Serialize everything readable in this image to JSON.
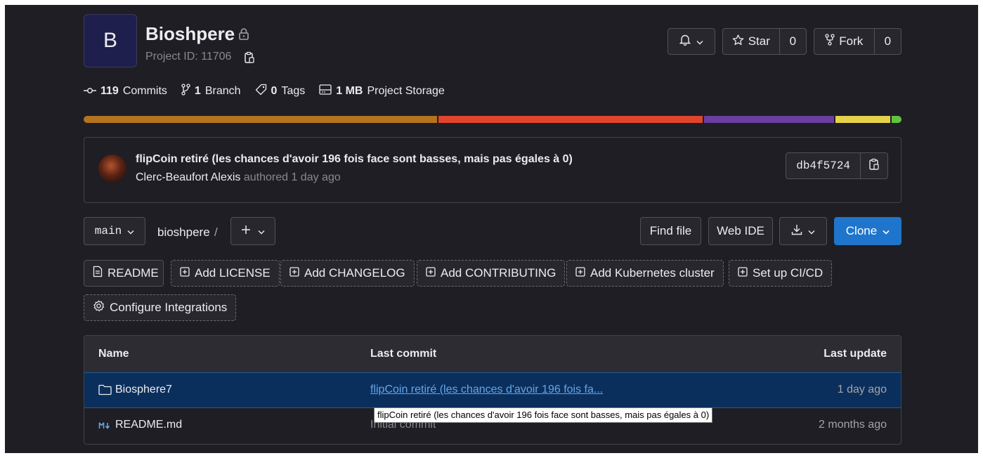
{
  "project": {
    "avatar_letter": "B",
    "title": "Bioshpere",
    "project_id": "Project ID: 11706"
  },
  "actions": {
    "star_label": "Star",
    "star_count": "0",
    "fork_label": "Fork",
    "fork_count": "0"
  },
  "stats": {
    "commits_count": "119",
    "commits_label": "Commits",
    "branch_count": "1",
    "branch_label": "Branch",
    "tags_count": "0",
    "tags_label": "Tags",
    "storage_size": "1 MB",
    "storage_label": "Project Storage"
  },
  "language_bar": [
    {
      "color": "#b5731d",
      "fraction": 0.435
    },
    {
      "color": "#e0452a",
      "fraction": 0.325
    },
    {
      "color": "#6a3fa0",
      "fraction": 0.16
    },
    {
      "color": "#e6d24a",
      "fraction": 0.068
    },
    {
      "color": "#5fc540",
      "fraction": 0.012
    }
  ],
  "last_commit": {
    "message": "flipCoin retiré (les chances d'avoir 196 fois face sont basses, mais pas égales à 0)",
    "author": "Clerc-Beaufort Alexis",
    "when": "authored 1 day ago",
    "sha": "db4f5724"
  },
  "toolbar": {
    "branch": "main",
    "path": "bioshpere",
    "path_sep": "/",
    "find_file": "Find file",
    "web_ide": "Web IDE",
    "clone": "Clone"
  },
  "quick_actions": [
    "README",
    "Add LICENSE",
    "Add CHANGELOG",
    "Add CONTRIBUTING",
    "Add Kubernetes cluster",
    "Set up CI/CD",
    "Configure Integrations"
  ],
  "table": {
    "headers": [
      "Name",
      "Last commit",
      "Last update"
    ],
    "rows": [
      {
        "name": "Biosphere7",
        "commit": "flipCoin retiré (les chances d'avoir 196 fois fa...",
        "updated": "1 day ago"
      },
      {
        "name": "README.md",
        "commit": "Initial commit",
        "updated": "2 months ago"
      }
    ]
  },
  "tooltip": "flipCoin retiré (les chances d'avoir 196 fois face sont basses, mais pas égales à 0)",
  "colors": {
    "background": "#1f1e24",
    "selected_row": "#0b2f5c",
    "link": "#63a6e9",
    "clone_button": "#1f75cb"
  }
}
